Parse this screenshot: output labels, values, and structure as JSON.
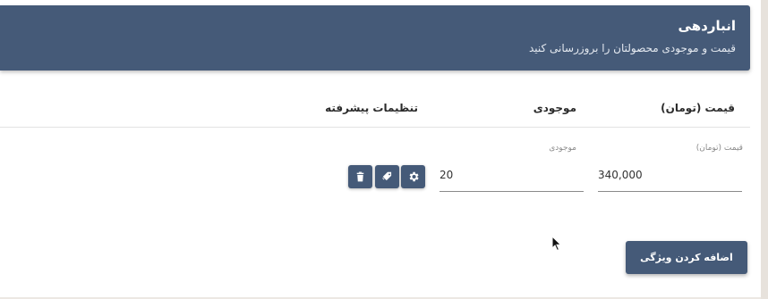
{
  "header": {
    "title": "انباردهی",
    "subtitle": "قیمت و موجودی محصولتان را بروزرسانی کنید"
  },
  "columns": {
    "price": "قیمت (تومان)",
    "stock": "موجودی",
    "advanced": "تنظیمات پیشرفته"
  },
  "row": {
    "price_label": "قیمت (تومان)",
    "price_value": "340,000",
    "stock_label": "موجودی",
    "stock_value": "20"
  },
  "actions": {
    "icons": [
      "gear-icon",
      "tag-icon",
      "trash-icon"
    ],
    "add_feature": "اضافه کردن ویژگی"
  },
  "colors": {
    "primary": "#455a78"
  }
}
